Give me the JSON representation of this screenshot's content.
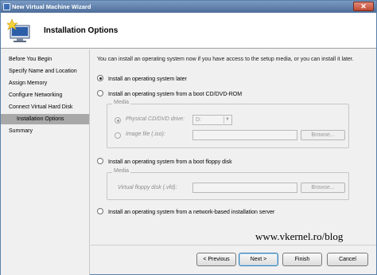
{
  "window": {
    "title": "New Virtual Machine Wizard",
    "close_label": "✕"
  },
  "header": {
    "title": "Installation Options"
  },
  "steps": [
    {
      "label": "Before You Begin"
    },
    {
      "label": "Specify Name and Location"
    },
    {
      "label": "Assign Memory"
    },
    {
      "label": "Configure Networking"
    },
    {
      "label": "Connect Virtual Hard Disk"
    },
    {
      "label": "Installation Options",
      "active": true
    },
    {
      "label": "Summary"
    }
  ],
  "intro": "You can install an operating system now if you have access to the setup media, or you can install it later.",
  "options": {
    "later": {
      "label": "Install an operating system later",
      "selected": true
    },
    "cd": {
      "label": "Install an operating system from a boot CD/DVD-ROM",
      "selected": false
    },
    "floppy": {
      "label": "Install an operating system from a boot floppy disk",
      "selected": false
    },
    "network": {
      "label": "Install an operating system from a network-based installation server",
      "selected": false
    }
  },
  "media_cd": {
    "group_label": "Media",
    "physical_label": "Physical CD/DVD drive:",
    "physical_value": "D:",
    "image_label": "Image file (.iso):",
    "image_value": "",
    "browse_label": "Browse..."
  },
  "media_floppy": {
    "group_label": "Media",
    "floppy_label": "Virtual floppy disk (.vfd):",
    "floppy_value": "",
    "browse_label": "Browse..."
  },
  "watermark": "www.vkernel.ro/blog",
  "buttons": {
    "previous": "< Previous",
    "next": "Next >",
    "finish": "Finish",
    "cancel": "Cancel"
  },
  "colors": {
    "titlebar": "#4d6d99",
    "active_step": "#a8a8a8",
    "disabled_text": "#8c8c8c"
  }
}
